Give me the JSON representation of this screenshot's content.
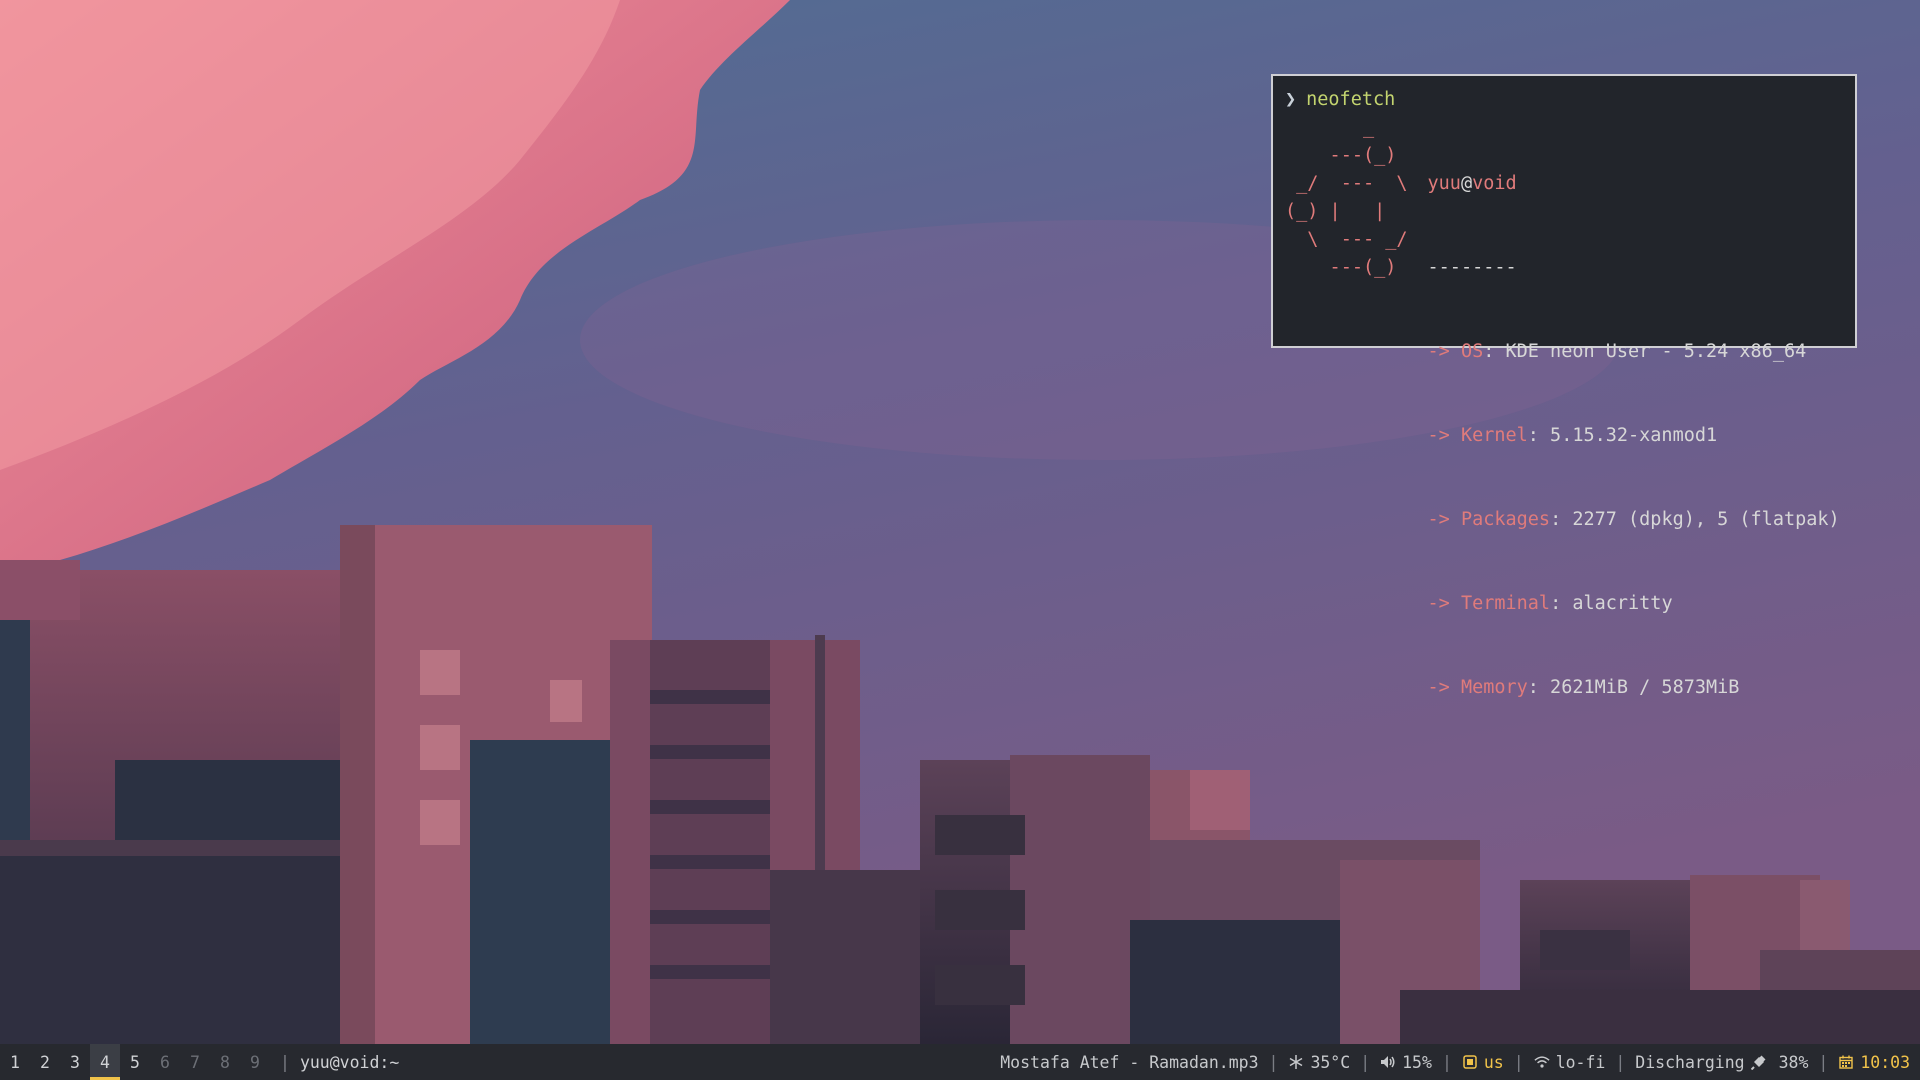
{
  "terminal": {
    "prompt_symbol": "❯",
    "command": "neofetch",
    "logo": "       _\n    ---(_)\n _/  ---  \\\n(_) |   |\n  \\  --- _/\n    ---(_)",
    "user": "yuu",
    "at": "@",
    "host": "void",
    "underline": "--------",
    "arrow": "->",
    "info": [
      {
        "key": "OS",
        "value": ": KDE neon User - 5.24 x86_64"
      },
      {
        "key": "Kernel",
        "value": ": 5.15.32-xanmod1"
      },
      {
        "key": "Packages",
        "value": ": 2277 (dpkg), 5 (flatpak)"
      },
      {
        "key": "Terminal",
        "value": ": alacritty"
      },
      {
        "key": "Memory",
        "value": ": 2621MiB / 5873MiB"
      }
    ]
  },
  "bar": {
    "workspaces": [
      "1",
      "2",
      "3",
      "4",
      "5",
      "6",
      "7",
      "8",
      "9"
    ],
    "active_workspace": "4",
    "separator": "|",
    "window_title": "yuu@void:~",
    "media": "Mostafa Atef - Ramadan.mp3",
    "temperature": "35°C",
    "volume": "15%",
    "keyboard_layout": "us",
    "network": "lo-fi",
    "battery_status": "Discharging",
    "battery_level": "38%",
    "clock": "10:03",
    "icons": {
      "temperature": "snowflake-icon",
      "volume": "speaker-icon",
      "keyboard": "keyboard-icon",
      "network": "wifi-icon",
      "battery": "plug-icon",
      "clock": "calendar-icon"
    },
    "accent_color": "#f1c34a"
  },
  "colors": {
    "bar_background": "#27292f",
    "terminal_background": "#22252b",
    "logo_color": "#e07b7b",
    "command_color": "#c3d46f"
  }
}
